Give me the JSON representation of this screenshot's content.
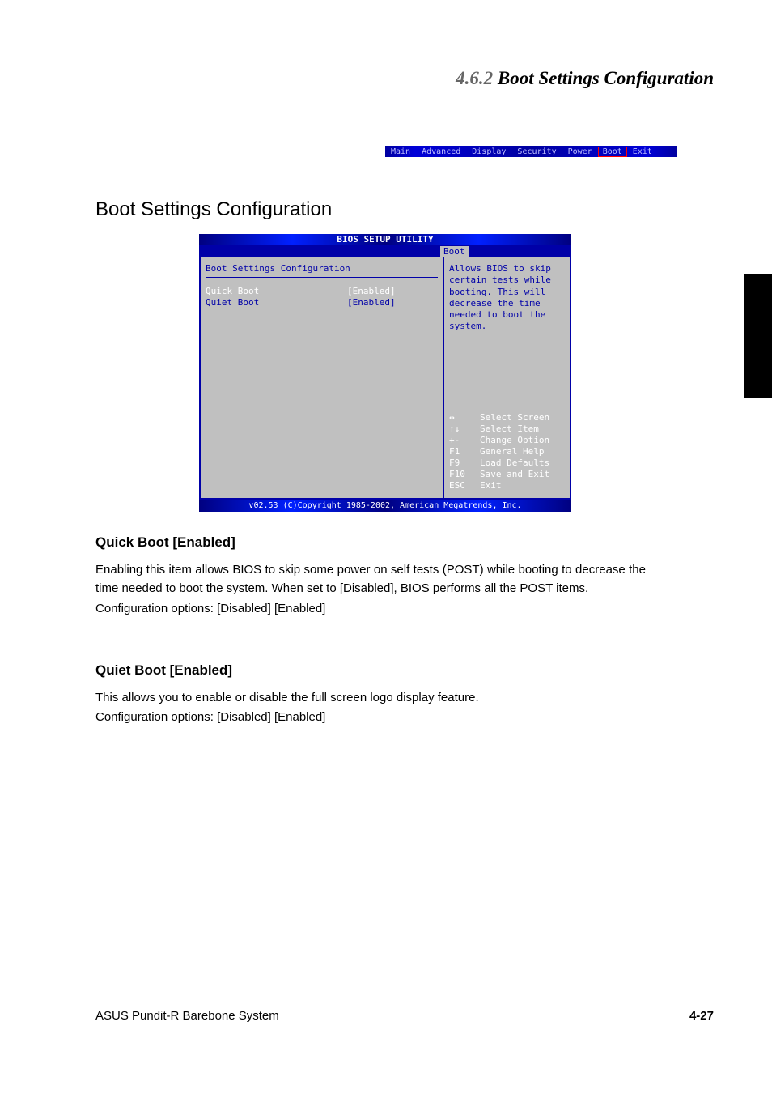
{
  "header": {
    "section_number": "4.6.2",
    "section_title": "Boot Settings Configuration"
  },
  "top_tabs": {
    "items": [
      "Main",
      "Advanced",
      "Display",
      "Security",
      "Power",
      "Boot",
      "Exit"
    ],
    "selected_index": 5
  },
  "subtitle": "Boot Settings Configuration",
  "bios": {
    "title": "BIOS SETUP UTILITY",
    "menu_active": "Boot",
    "section_header": "Boot Settings Configuration",
    "rows": [
      {
        "label": "Quick Boot",
        "value": "[Enabled]",
        "selected": true
      },
      {
        "label": "Quiet Boot",
        "value": "[Enabled]",
        "selected": false
      }
    ],
    "help_text": "Allows BIOS to skip certain tests while booting. This will decrease the time needed to boot the system.",
    "nav": [
      {
        "key": "↔",
        "action": "Select Screen"
      },
      {
        "key": "↑↓",
        "action": "Select Item"
      },
      {
        "key": "+-",
        "action": "Change Option"
      },
      {
        "key": "F1",
        "action": "General Help"
      },
      {
        "key": "F9",
        "action": "Load Defaults"
      },
      {
        "key": "F10",
        "action": "Save and Exit"
      },
      {
        "key": "ESC",
        "action": "Exit"
      }
    ],
    "footer": "v02.53 (C)Copyright 1985-2002, American Megatrends, Inc."
  },
  "quick_boot": {
    "heading": "Quick Boot [Enabled]",
    "body": "Enabling this item allows BIOS to skip some power on self tests (POST) while booting to decrease the time needed to boot the system. When set to [Disabled], BIOS performs all the POST items.",
    "values": "Configuration options: [Disabled] [Enabled]"
  },
  "quiet_boot": {
    "heading": "Quiet Boot [Enabled]",
    "body": "This allows you to enable or disable the full screen logo display feature.",
    "values": "Configuration options: [Disabled] [Enabled]"
  },
  "footer": {
    "text": "ASUS Pundit-R Barebone System",
    "page": "4-27"
  }
}
